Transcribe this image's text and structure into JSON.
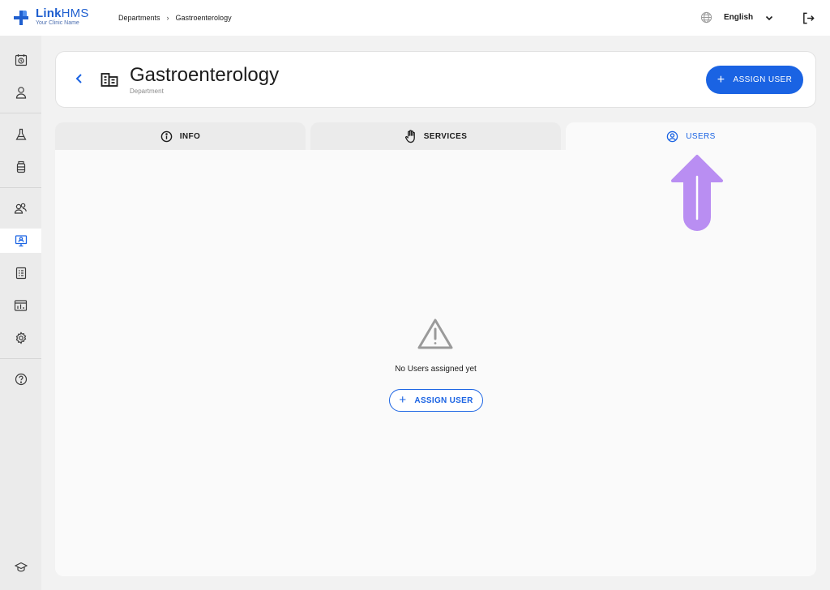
{
  "app": {
    "title_bold": "Link",
    "title_rest": "HMS",
    "subtitle": "Your Clinic Name"
  },
  "breadcrumb": {
    "items": [
      "Departments",
      "Gastroenterology"
    ],
    "separator": "›"
  },
  "header_right": {
    "language": "English"
  },
  "sidebar": {
    "active_item": "departments"
  },
  "page": {
    "title": "Gastroenterology",
    "subtitle": "Department",
    "assign_button_label": "ASSIGN USER"
  },
  "tabs": [
    {
      "label": "INFO",
      "icon": "info-icon",
      "active": false
    },
    {
      "label": "SERVICES",
      "icon": "hand-icon",
      "active": false
    },
    {
      "label": "USERS",
      "icon": "user-circle-icon",
      "active": true
    }
  ],
  "empty_state": {
    "icon": "warning-icon",
    "message": "No Users assigned yet",
    "button_label": "ASSIGN USER"
  },
  "colors": {
    "accent": "#1a63e3",
    "annotation": "#b98ef2"
  }
}
